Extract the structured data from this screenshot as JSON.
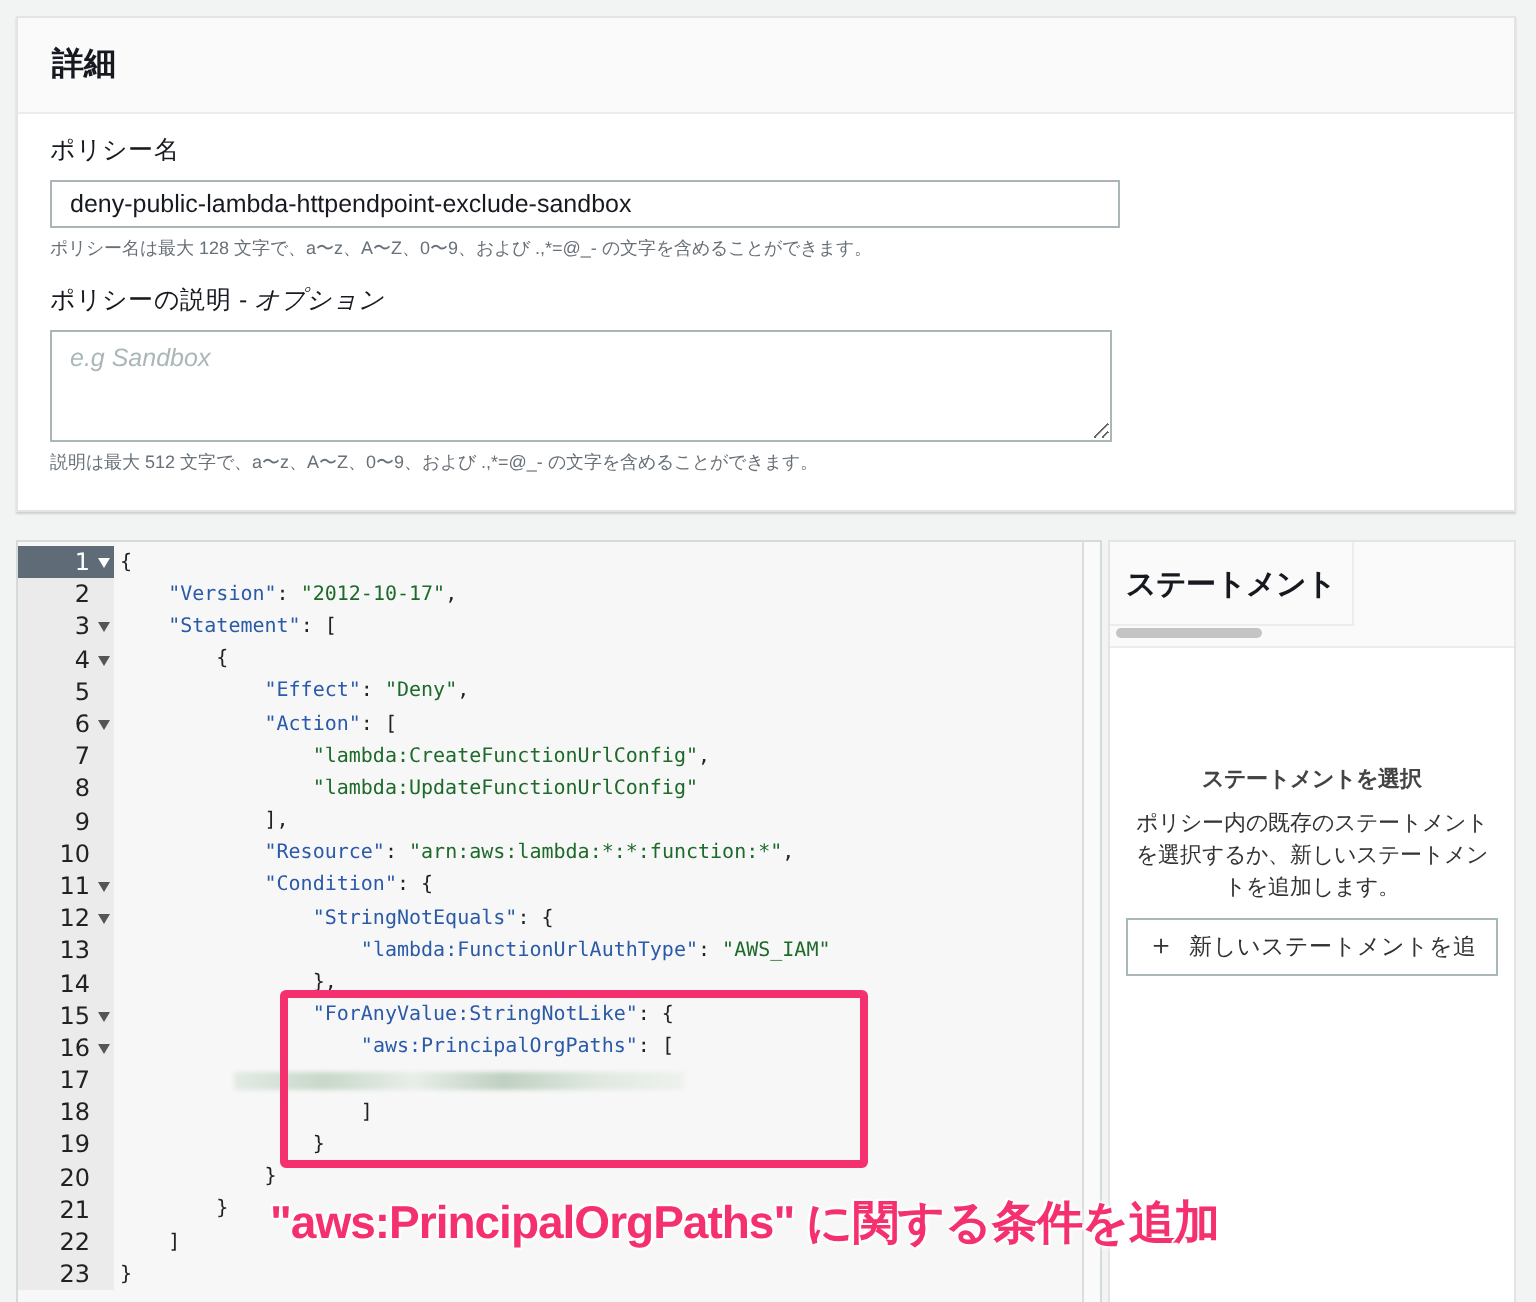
{
  "details": {
    "title": "詳細",
    "name_field": {
      "label": "ポリシー名",
      "value": "deny-public-lambda-httpendpoint-exclude-sandbox",
      "hint": "ポリシー名は最大 128 文字で、a〜z、A〜Z、0〜9、および .,*=@_- の文字を含めることができます。"
    },
    "description_field": {
      "label": "ポリシーの説明 - ",
      "label_suffix": "オプション",
      "placeholder": "e.g Sandbox",
      "hint": "説明は最大 512 文字で、a〜z、A〜Z、0〜9、および .,*=@_- の文字を含めることができます。"
    }
  },
  "editor": {
    "lines": [
      {
        "number": "1",
        "foldable": true,
        "current": true,
        "text": "{"
      },
      {
        "number": "2",
        "foldable": false,
        "current": false,
        "text": "    \"Version\": \"2012-10-17\","
      },
      {
        "number": "3",
        "foldable": true,
        "current": false,
        "text": "    \"Statement\": ["
      },
      {
        "number": "4",
        "foldable": true,
        "current": false,
        "text": "        {"
      },
      {
        "number": "5",
        "foldable": false,
        "current": false,
        "text": "            \"Effect\": \"Deny\","
      },
      {
        "number": "6",
        "foldable": true,
        "current": false,
        "text": "            \"Action\": ["
      },
      {
        "number": "7",
        "foldable": false,
        "current": false,
        "text": "                \"lambda:CreateFunctionUrlConfig\","
      },
      {
        "number": "8",
        "foldable": false,
        "current": false,
        "text": "                \"lambda:UpdateFunctionUrlConfig\""
      },
      {
        "number": "9",
        "foldable": false,
        "current": false,
        "text": "            ],"
      },
      {
        "number": "10",
        "foldable": false,
        "current": false,
        "text": "            \"Resource\": \"arn:aws:lambda:*:*:function:*\","
      },
      {
        "number": "11",
        "foldable": true,
        "current": false,
        "text": "            \"Condition\": {"
      },
      {
        "number": "12",
        "foldable": true,
        "current": false,
        "text": "                \"StringNotEquals\": {"
      },
      {
        "number": "13",
        "foldable": false,
        "current": false,
        "text": "                    \"lambda:FunctionUrlAuthType\": \"AWS_IAM\""
      },
      {
        "number": "14",
        "foldable": false,
        "current": false,
        "text": "                },"
      },
      {
        "number": "15",
        "foldable": true,
        "current": false,
        "text": "                \"ForAnyValue:StringNotLike\": {"
      },
      {
        "number": "16",
        "foldable": true,
        "current": false,
        "text": "                    \"aws:PrincipalOrgPaths\": ["
      },
      {
        "number": "17",
        "foldable": false,
        "current": false,
        "redacted": true
      },
      {
        "number": "18",
        "foldable": false,
        "current": false,
        "text": "                    ]"
      },
      {
        "number": "19",
        "foldable": false,
        "current": false,
        "text": "                }"
      },
      {
        "number": "20",
        "foldable": false,
        "current": false,
        "text": "            }"
      },
      {
        "number": "21",
        "foldable": false,
        "current": false,
        "text": "        }"
      },
      {
        "number": "22",
        "foldable": false,
        "current": false,
        "text": "    ]"
      },
      {
        "number": "23",
        "foldable": false,
        "current": false,
        "text": "}"
      }
    ]
  },
  "statement_panel": {
    "tab": "ステートメント",
    "heading": "ステートメントを選択",
    "description": "ポリシー内の既存のステートメントを選択するか、新しいステートメントを追加します。",
    "button": {
      "icon": "＋",
      "label": "新しいステートメントを追"
    }
  },
  "annotation": {
    "text": "\"aws:PrincipalOrgPaths\" に関する条件を追加"
  }
}
